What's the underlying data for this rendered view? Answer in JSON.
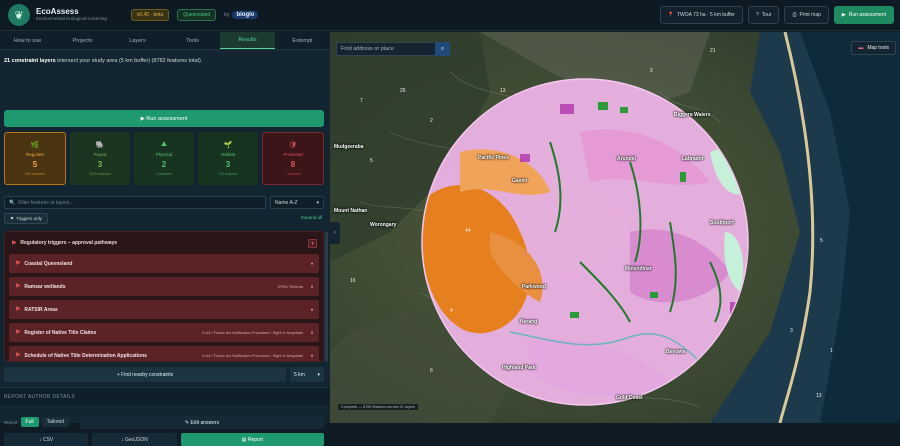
{
  "app": {
    "name": "EcoAssess",
    "tagline": "Environmental ecological screening",
    "version_badge": "v0.45 · beta",
    "state_badge": "Queensland",
    "by_label": "by",
    "partner": "bioglo"
  },
  "toolbar": {
    "location_chip": "TWOA 73 ha · 5 km buffer",
    "tour": "Tour",
    "print_map": "Print map",
    "run_assessment": "Run assessment"
  },
  "tabs": [
    "How to use",
    "Projects",
    "Layers",
    "Tools",
    "Results",
    "Extempt"
  ],
  "summary": {
    "count": "21 constraint layers",
    "rest": " intersect your study area (5 km buffer) (8782 features total)"
  },
  "run_button": "▶ Run assessment",
  "categories": [
    {
      "icon": "🌿",
      "label": "Regulate",
      "count": "5",
      "sub": "204 features"
    },
    {
      "icon": "🐘",
      "label": "Fauna",
      "count": "3",
      "sub": "1020 features"
    },
    {
      "icon": "⛰",
      "label": "Physical",
      "count": "2",
      "sub": "2 features"
    },
    {
      "icon": "🌱",
      "label": "Habitat",
      "count": "3",
      "sub": "212 features"
    },
    {
      "icon": "🛡",
      "label": "Protected",
      "count": "8",
      "sub": "7 features"
    }
  ],
  "filter": {
    "placeholder": "Filter features or layers...",
    "sort": "Name A-Z",
    "triggers_only": "Triggers only",
    "expand_all": "Expand all"
  },
  "reg_group": {
    "title": "Regulatory triggers – approval pathways",
    "count": "7",
    "items": [
      {
        "name": "Coastal Queensland",
        "meta": ""
      },
      {
        "name": "Ramsar wetlands",
        "meta": "EPBC Referral"
      },
      {
        "name": "RATSIR Areas",
        "meta": ""
      },
      {
        "name": "Register of Native Title Claims",
        "meta": "ILUA / Future Act Notification Procedure / Right to Negotiate"
      },
      {
        "name": "Schedule of Native Title Determination Applications",
        "meta": "ILUA / Future Act Notification Procedure / Right to Negotiate"
      }
    ]
  },
  "nearby": {
    "label": "+ Find nearby constraints",
    "distance": "5 km"
  },
  "report_section": "REPORT AUTHOR DETAILS",
  "report": {
    "label": "Report",
    "full": "Full",
    "tailored": "Tailored",
    "edit_answers": "✎ Edit answers",
    "csv": "↓ CSV",
    "geojson": "↓ GeoJSON",
    "report_btn": "▤ Report"
  },
  "map": {
    "search_placeholder": "Find address or place",
    "tools": "Map tools",
    "status": "Complete — 8782 features across 21 layers",
    "places": [
      {
        "name": "Mudgeeraba"
      },
      {
        "name": "Worongary"
      },
      {
        "name": "Mount Nathan"
      },
      {
        "name": "Gaven"
      },
      {
        "name": "Arundel"
      },
      {
        "name": "Labrador"
      },
      {
        "name": "Biggera Waters"
      },
      {
        "name": "Southport"
      },
      {
        "name": "Molendinar"
      },
      {
        "name": "Parkwood"
      },
      {
        "name": "Nerang"
      },
      {
        "name": "Benowa"
      },
      {
        "name": "Highland Park"
      },
      {
        "name": "Gold Coast"
      },
      {
        "name": "Pacific Pines"
      }
    ]
  },
  "colors": {
    "accent": "#1f9a6e",
    "buffer": "#f2a6e6",
    "forest": "#e6801e"
  }
}
